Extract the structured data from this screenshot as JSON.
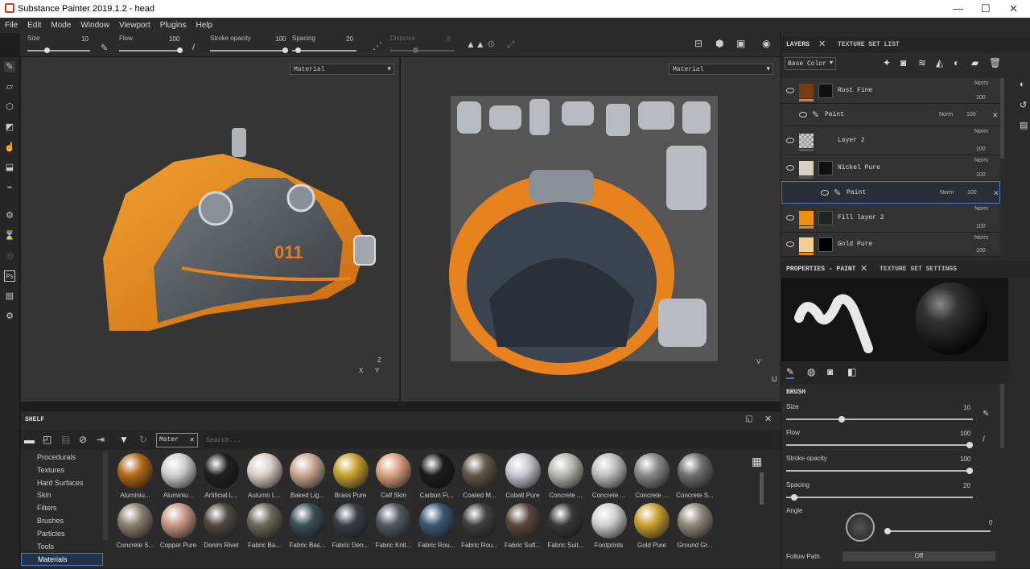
{
  "window": {
    "title": "Substance Painter 2019.1.2 - head",
    "min": "—",
    "max": "☐",
    "close": "✕"
  },
  "menu": [
    "File",
    "Edit",
    "Mode",
    "Window",
    "Viewport",
    "Plugins",
    "Help"
  ],
  "toolbar": {
    "size_label": "Size",
    "size_value": "10",
    "flow_label": "Flow",
    "flow_value": "100",
    "opacity_label": "Stroke opacity",
    "opacity_value": "100",
    "spacing_label": "Spacing",
    "spacing_value": "20",
    "distance_label": "Distance",
    "distance_value": "8"
  },
  "viewport": {
    "left_mode": "Material",
    "right_mode": "Material",
    "uv_label": "U",
    "uv_label_v": "V",
    "axis_x": "X",
    "axis_y": "Y",
    "axis_z": "Z"
  },
  "shelf": {
    "title": "SHELF",
    "filter_tag": "Mater",
    "search_placeholder": "Search...",
    "categories": [
      "Procedurals",
      "Textures",
      "Hard Surfaces",
      "Skin",
      "Filters",
      "Brushes",
      "Particles",
      "Tools",
      "Materials"
    ],
    "selected_category": "Materials",
    "materials_row1": [
      "Aluminiu...",
      "Aluminiu...",
      "Artificial L...",
      "Autumn L...",
      "Baked Lig...",
      "Brass Pure",
      "Calf Skin",
      "Carbon Fi...",
      "Coated M...",
      "Cobalt Pure",
      "Concrete ...",
      "Concrete ...",
      "Concrete ...",
      "Concrete S..."
    ],
    "materials_row2": [
      "Concrete S...",
      "Copper Pure",
      "Denim Rivet",
      "Fabric Ba...",
      "Fabric Bas...",
      "Fabric Den...",
      "Fabric Knit...",
      "Fabric Rou...",
      "Fabric Rou...",
      "Fabric Soft...",
      "Fabric Suit...",
      "Footprints",
      "Gold Pure",
      "Ground Gr..."
    ],
    "colors_row1": [
      "#b06a18",
      "#d0d0d0",
      "#202020",
      "#d8d0c8",
      "#c8a890",
      "#c8a030",
      "#d8a080",
      "#1a1a1a",
      "#605848",
      "#c8c8d0",
      "#b8b8b0",
      "#c0c0c0",
      "#888888",
      "#707070"
    ],
    "colors_row2": [
      "#8a8070",
      "#c89888",
      "#504840",
      "#6a6858",
      "#3a5058",
      "#3a3e44",
      "#505860",
      "#3a5870",
      "#404040",
      "#5a4840",
      "#383838",
      "#d0d0d0",
      "#c8a030",
      "#908878"
    ]
  },
  "layers": {
    "tab_layers": "LAYERS",
    "tab_texset": "TEXTURE SET LIST",
    "channel": "Base Color",
    "rows": [
      {
        "name": "Rust Fine",
        "blend": "Norm",
        "opacity": "100"
      },
      {
        "name": "Paint",
        "blend": "Norm",
        "opacity": "100"
      },
      {
        "name": "Layer 2",
        "blend": "Norm",
        "opacity": "100"
      },
      {
        "name": "Nickel Pure",
        "blend": "Norm",
        "opacity": "100"
      },
      {
        "name": "Paint",
        "blend": "Norm",
        "opacity": "100"
      },
      {
        "name": "Fill layer 2",
        "blend": "Norm",
        "opacity": "100"
      },
      {
        "name": "Gold Pure",
        "blend": "Norm",
        "opacity": "100"
      }
    ]
  },
  "properties": {
    "tab_paint": "PROPERTIES - PAINT",
    "tab_texsettings": "TEXTURE SET SETTINGS",
    "section": "BRUSH",
    "size_label": "Size",
    "size_value": "10",
    "flow_label": "Flow",
    "flow_value": "100",
    "opacity_label": "Stroke opacity",
    "opacity_value": "100",
    "spacing_label": "Spacing",
    "spacing_value": "20",
    "angle_label": "Angle",
    "angle_value": "0",
    "follow_label": "Follow Path",
    "follow_value": "Off"
  },
  "colors": {
    "accent": "#4a7ac0",
    "orange": "#e8821e"
  }
}
